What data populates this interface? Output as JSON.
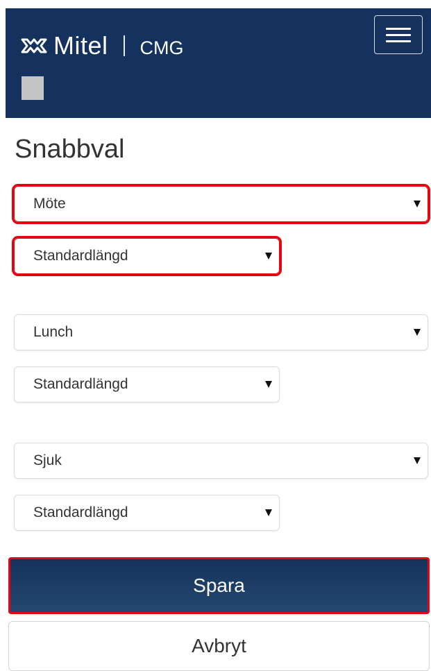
{
  "header": {
    "brand": "Mitel",
    "app_name": "CMG",
    "colors": {
      "background": "#15325e",
      "text": "#ffffff"
    }
  },
  "page": {
    "title": "Snabbval"
  },
  "presets": [
    {
      "status": "Möte",
      "duration": "Standardlängd"
    },
    {
      "status": "Lunch",
      "duration": "Standardlängd"
    },
    {
      "status": "Sjuk",
      "duration": "Standardlängd"
    }
  ],
  "actions": {
    "save_label": "Spara",
    "cancel_label": "Avbryt"
  },
  "icons": {
    "logo": "mitel-logo-icon",
    "menu": "hamburger-menu-icon",
    "dropdown": "dropdown-arrow-icon"
  },
  "highlight_color": "#e30613"
}
